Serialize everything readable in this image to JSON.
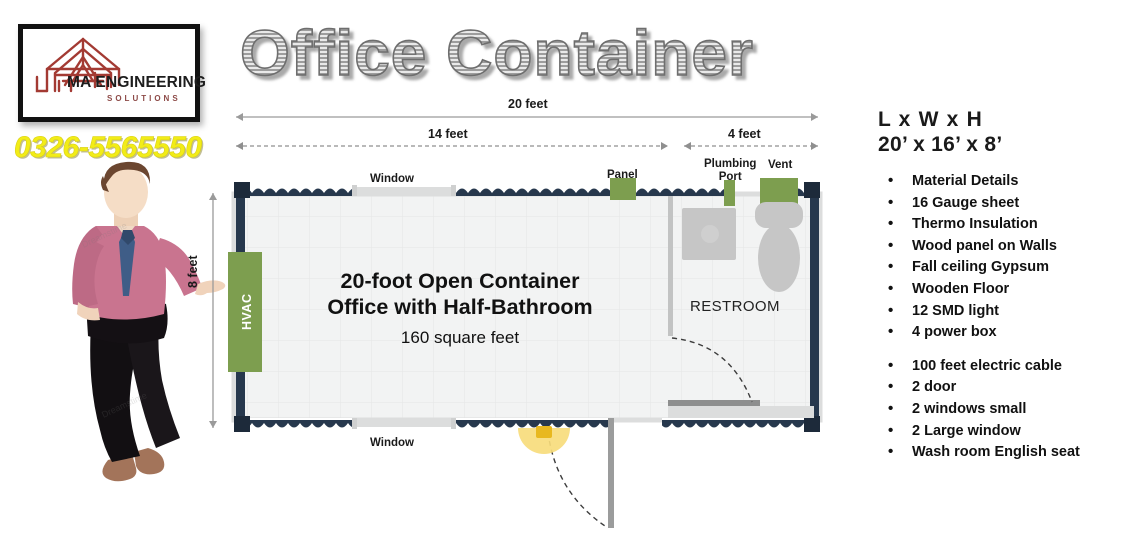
{
  "brand": {
    "logo_name": "MA ENGINEERING",
    "logo_sub": "SOLUTIONS",
    "logo_icon": "roof-truss-icon",
    "phone": "0326-5565550",
    "phone_color": "#f2ec17"
  },
  "header": {
    "title": "Office Container"
  },
  "plan": {
    "dimensions": {
      "overall_top": "20 feet",
      "office_span": "14 feet",
      "restroom_span": "4 feet",
      "height_left": "8 feet"
    },
    "labels": {
      "window_top": "Window",
      "window_bottom": "Window",
      "panel": "Panel",
      "plumbing_port": "Plumbing\nPort",
      "plumbing_port_line1": "Plumbing",
      "plumbing_port_line2": "Port",
      "vent": "Vent",
      "hvac": "HVAC",
      "restroom": "RESTROOM"
    },
    "room": {
      "title_line1": "20-foot Open Container",
      "title_line2": "Office with Half-Bathroom",
      "area": "160 square feet"
    },
    "colors": {
      "wall": "#27384d",
      "green_marker": "#7d9e4f",
      "floor": "#f2f3f3",
      "grid": "#e2e4e5",
      "window": "#dcdddd",
      "fixture": "#c6c6c6",
      "light": "#f5d76e"
    }
  },
  "spec": {
    "dim_header": "L  x  W x H",
    "dim_value": "20’ x 16’ x 8’",
    "items": [
      {
        "label": "Material Details",
        "gap": false
      },
      {
        "label": "16 Gauge sheet",
        "gap": false
      },
      {
        "label": "Thermo Insulation",
        "gap": false
      },
      {
        "label": "Wood panel on Walls",
        "gap": false
      },
      {
        "label": "Fall ceiling Gypsum",
        "gap": false
      },
      {
        "label": "Wooden Floor",
        "gap": false
      },
      {
        "label": "12 SMD light",
        "gap": false
      },
      {
        "label": "4 power box",
        "gap": false
      },
      {
        "label": "100 feet electric cable",
        "gap": true
      },
      {
        "label": "2 door",
        "gap": false
      },
      {
        "label": "2 windows small",
        "gap": false
      },
      {
        "label": "2 Large window",
        "gap": false
      },
      {
        "label": "Wash room English seat",
        "gap": false
      }
    ],
    "bullet": "•"
  }
}
